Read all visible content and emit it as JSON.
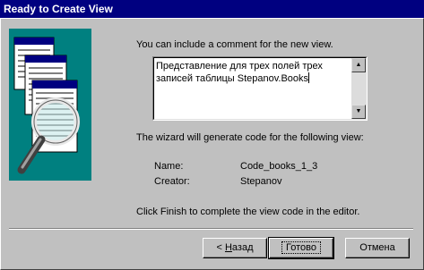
{
  "window": {
    "title": "Ready to Create View"
  },
  "comment_prompt": "You can include a comment for the new view.",
  "comment_text": "Представление для трех полей трех записей таблицы Stepanov.Books",
  "wizard_message": "The wizard will generate code for the following view:",
  "details": {
    "name_label": "Name:",
    "name_value": "Code_books_1_3",
    "creator_label": "Creator:",
    "creator_value": "Stepanov"
  },
  "finish_hint": "Click Finish to complete the view code in the editor.",
  "buttons": {
    "back": {
      "prefix": "< ",
      "underline": "Н",
      "rest": "азад"
    },
    "finish": "Готово",
    "cancel": "Отмена"
  },
  "colors": {
    "titlebar": "#000080",
    "art_background": "#008080",
    "dialog_face": "#c0c0c0"
  },
  "icons": {
    "art": "documents-magnifier-illustration",
    "scroll_up": "arrow-up-icon",
    "scroll_down": "arrow-down-icon"
  }
}
